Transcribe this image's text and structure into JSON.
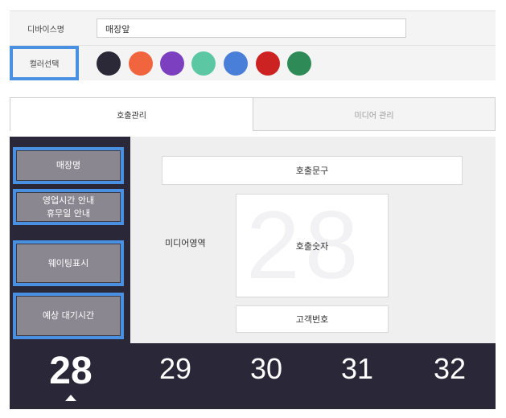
{
  "settings": {
    "device_name_label": "디바이스명",
    "device_name_value": "매장앞",
    "color_select_label": "컬러선택",
    "colors": [
      "#2b2938",
      "#f0643e",
      "#7b3fbf",
      "#5cc7a3",
      "#4a7fd9",
      "#cc2222",
      "#2e8a57"
    ]
  },
  "tabs": {
    "call_management": "호출관리",
    "media_management": "미디어 관리"
  },
  "left_menu": {
    "store_name": "매장명",
    "hours_line1": "영업시간 안내",
    "hours_line2": "휴무일 안내",
    "waiting_display": "웨이팅표시",
    "expected_wait": "예상 대기시간"
  },
  "preview": {
    "call_phrase": "호출문구",
    "media_area": "미디어영역",
    "call_number": "호출숫자",
    "call_number_bg": "28",
    "customer_number": "고객번호"
  },
  "number_bar": {
    "current": "28",
    "upcoming": [
      "29",
      "30",
      "31",
      "32"
    ]
  }
}
